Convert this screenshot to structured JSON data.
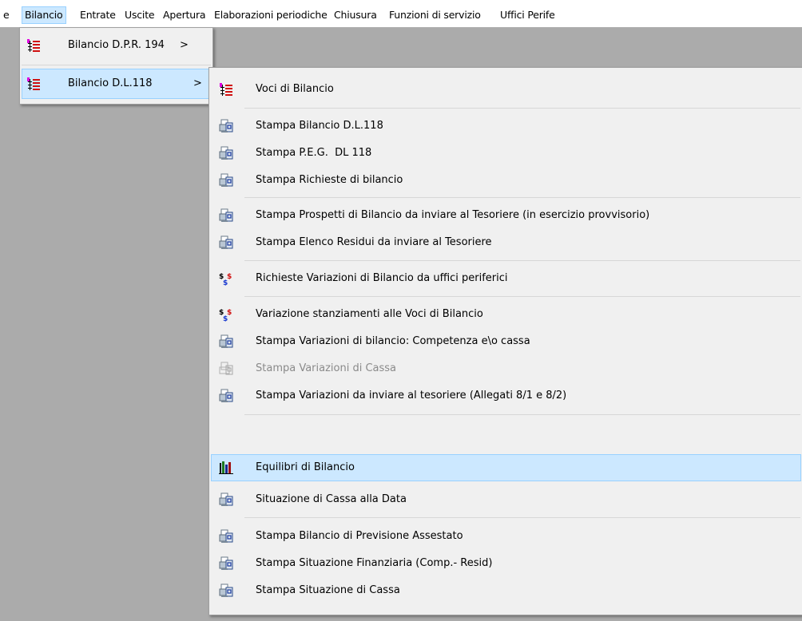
{
  "menubar": {
    "items": [
      {
        "label": "e"
      },
      {
        "label": "Bilancio"
      },
      {
        "label": "Entrate"
      },
      {
        "label": "Uscite"
      },
      {
        "label": "Apertura"
      },
      {
        "label": "Elaborazioni periodiche"
      },
      {
        "label": "Chiusura"
      },
      {
        "label": "Funzioni di servizio"
      },
      {
        "label": "Uffici Perife"
      }
    ]
  },
  "submenu_bilancio": {
    "items": [
      {
        "label": "Bilancio D.P.R. 194",
        "arrow": ">",
        "icon": "list-icon"
      },
      {
        "label": "Bilancio D.L.118",
        "arrow": ">",
        "icon": "list-icon"
      }
    ]
  },
  "submenu_dl118": {
    "items": [
      {
        "label": "Voci di Bilancio",
        "icon": "list-icon"
      },
      {
        "label": "Stampa Bilancio D.L.118",
        "icon": "print-icon"
      },
      {
        "label": "Stampa P.E.G.  DL 118",
        "icon": "print-icon"
      },
      {
        "label": "Stampa Richieste di bilancio",
        "icon": "print-icon"
      },
      {
        "label": "Stampa Prospetti di Bilancio da inviare al Tesoriere (in esercizio provvisorio)",
        "icon": "print-icon"
      },
      {
        "label": "Stampa Elenco Residui da inviare al Tesoriere",
        "icon": "print-icon"
      },
      {
        "label": "Richieste Variazioni di Bilancio da uffici periferici",
        "icon": "dollar-icon"
      },
      {
        "label": "Variazione stanziamenti alle Voci di Bilancio",
        "icon": "dollar-icon"
      },
      {
        "label": "Stampa Variazioni di bilancio: Competenza e\\o cassa",
        "icon": "print-icon"
      },
      {
        "label": "Stampa Variazioni di Cassa",
        "icon": "print-icon"
      },
      {
        "label": "Stampa Variazioni da inviare al tesoriere (Allegati 8/1 e 8/2)",
        "icon": "print-icon"
      },
      {
        "label": "Equilibri di Bilancio",
        "icon": "bar-chart-icon"
      },
      {
        "label": "Situazione di Cassa alla Data",
        "icon": "print-icon"
      },
      {
        "label": "Stampa Bilancio di Previsione Assestato",
        "icon": "print-icon"
      },
      {
        "label": "Stampa Situazione Finanziaria (Comp.- Resid)",
        "icon": "print-icon"
      },
      {
        "label": "Stampa Situazione di Cassa",
        "icon": "print-icon"
      }
    ]
  },
  "colors": {
    "highlight": "#cce8ff",
    "highlight_border": "#99d1ff",
    "menu_bg": "#f0f0f0",
    "desktop_bg": "#ababab",
    "disabled_text": "#8a8a8a"
  }
}
